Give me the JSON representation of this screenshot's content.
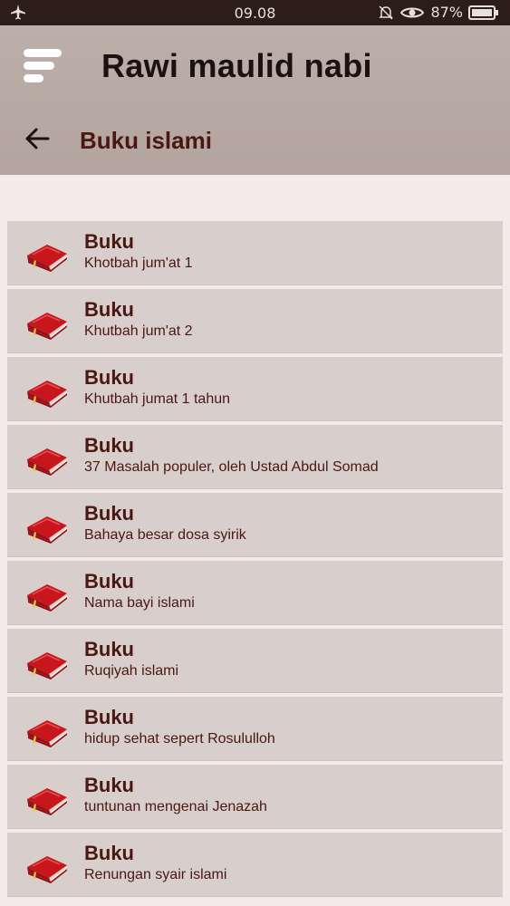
{
  "status_bar": {
    "time": "09.08",
    "battery_percent": "87%",
    "icons": [
      "airplane-icon",
      "bell-off-icon",
      "eye-icon",
      "battery-icon"
    ]
  },
  "header": {
    "app_title": "Rawi maulid nabi",
    "page_title": "Buku islami"
  },
  "colors": {
    "header_bg": "#b6a7a1",
    "item_bg": "#d8cfcc",
    "text_primary": "#4a1712",
    "book_red": "#c0131a"
  },
  "list": {
    "items": [
      {
        "title": "Buku",
        "subtitle": "Khotbah jum'at 1"
      },
      {
        "title": "Buku",
        "subtitle": "Khutbah jum'at 2"
      },
      {
        "title": "Buku",
        "subtitle": "Khutbah jumat 1 tahun"
      },
      {
        "title": "Buku",
        "subtitle": "37 Masalah populer, oleh Ustad Abdul Somad"
      },
      {
        "title": "Buku",
        "subtitle": "Bahaya besar dosa syirik"
      },
      {
        "title": "Buku",
        "subtitle": "Nama bayi islami"
      },
      {
        "title": "Buku",
        "subtitle": "Ruqiyah islami"
      },
      {
        "title": "Buku",
        "subtitle": "hidup sehat sepert Rosululloh"
      },
      {
        "title": "Buku",
        "subtitle": "tuntunan mengenai Jenazah"
      },
      {
        "title": "Buku",
        "subtitle": "Renungan syair islami"
      }
    ]
  }
}
